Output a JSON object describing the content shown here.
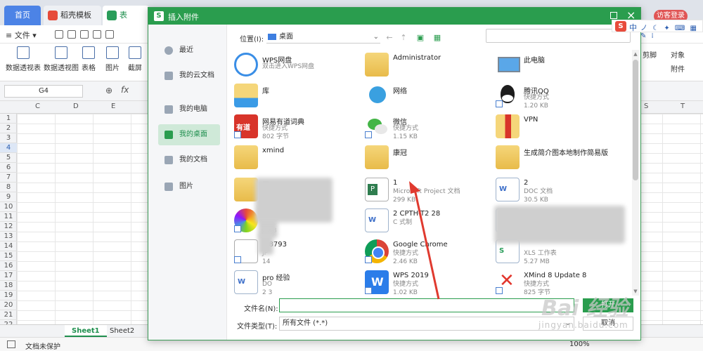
{
  "tabs": [
    {
      "label": "首页"
    },
    {
      "label": "稻壳模板"
    },
    {
      "label": "表格.xls"
    }
  ],
  "guest_login": "访客登录",
  "menu": {
    "file": "文件"
  },
  "ribbon": {
    "buttons": [
      "数据透视表",
      "数据透视图",
      "表格",
      "图片",
      "截屏"
    ],
    "right": [
      "剪脚",
      "对象",
      "附件"
    ]
  },
  "formula_bar": {
    "cell": "G4",
    "fx": "fx"
  },
  "columns": [
    "C",
    "D",
    "E",
    "S",
    "T"
  ],
  "rows": [
    "1",
    "2",
    "3",
    "4",
    "5",
    "6",
    "7",
    "8",
    "9",
    "10",
    "11",
    "12",
    "13",
    "14",
    "15",
    "16",
    "17",
    "18",
    "19",
    "20",
    "21",
    "22"
  ],
  "active_row": "4",
  "sheets": [
    "Sheet1",
    "Sheet2"
  ],
  "status": {
    "protect": "文档未保护",
    "zoom": "100%"
  },
  "dialog": {
    "title": "插入附件",
    "sidebar": [
      {
        "label": "最近",
        "icon": "clock-icon"
      },
      {
        "label": "我的云文档",
        "icon": "cloud-icon"
      },
      {
        "label": "我的电脑",
        "icon": "computer-icon"
      },
      {
        "label": "我的桌面",
        "icon": "desktop-icon",
        "active": true
      },
      {
        "label": "我的文档",
        "icon": "folder-icon"
      },
      {
        "label": "图片",
        "icon": "image-icon"
      }
    ],
    "location_label": "位置(I):",
    "location_value": "桌面",
    "files": [
      {
        "name": "WPS网盘",
        "sub1": "双击进入WPS网盘",
        "sub2": "",
        "icon": "cloud"
      },
      {
        "name": "Administrator",
        "sub1": "",
        "sub2": "",
        "icon": "folder"
      },
      {
        "name": "此电脑",
        "sub1": "",
        "sub2": "",
        "icon": "pc"
      },
      {
        "name": "库",
        "sub1": "",
        "sub2": "",
        "icon": "lib"
      },
      {
        "name": "网络",
        "sub1": "",
        "sub2": "",
        "icon": "net"
      },
      {
        "name": "腾讯QQ",
        "sub1": "快捷方式",
        "sub2": "1.20 KB",
        "icon": "qq"
      },
      {
        "name": "网易有道词典",
        "sub1": "快捷方式",
        "sub2": "802 字节",
        "icon": "red"
      },
      {
        "name": "微信",
        "sub1": "快捷方式",
        "sub2": "1.15 KB",
        "icon": "wechat"
      },
      {
        "name": "VPN",
        "sub1": "",
        "sub2": "",
        "icon": "vpn"
      },
      {
        "name": "xmind",
        "sub1": "",
        "sub2": "",
        "icon": "folder"
      },
      {
        "name": "康冠",
        "sub1": "",
        "sub2": "",
        "icon": "folder"
      },
      {
        "name": "生成简介图本地制作简易版",
        "sub1": "",
        "sub2": "",
        "icon": "folder"
      },
      {
        "name": "图",
        "sub1": "",
        "sub2": "",
        "icon": "folder"
      },
      {
        "name": "1",
        "sub1": "Microsoft Project 文档",
        "sub2": "299 KB",
        "icon": "proj"
      },
      {
        "name": "2",
        "sub1": "DOC 文档",
        "sub2": "30.5 KB",
        "icon": "doc"
      },
      {
        "name": "3",
        "sub1": "器",
        "sub2": "1 KB",
        "icon": "color"
      },
      {
        "name": "2 CPTH-T2 28",
        "sub1": "C 式制",
        "sub2": "",
        "icon": "doc"
      },
      {
        "name": "",
        "sub1": "DOC 文档",
        "sub2": "",
        "icon": "doc"
      },
      {
        "name": "1 8793",
        "sub1": "JP",
        "sub2": "14",
        "icon": "jpg"
      },
      {
        "name": "Google Chrome",
        "sub1": "快捷方式",
        "sub2": "2.46 KB",
        "icon": "chrome"
      },
      {
        "name": "",
        "sub1": "XLS 工作表",
        "sub2": "5.27 MB",
        "icon": "xls"
      },
      {
        "name": "pro 经验",
        "sub1": "DO",
        "sub2": "2 3",
        "icon": "doc"
      },
      {
        "name": "WPS 2019",
        "sub1": "快捷方式",
        "sub2": "1.02 KB",
        "icon": "wps"
      },
      {
        "name": "XMind 8 Update 8",
        "sub1": "快捷方式",
        "sub2": "825 字节",
        "icon": "xmind"
      }
    ],
    "filename_label": "文件名(N):",
    "filename_value": "",
    "open_label": "打开",
    "filetype_label": "文件类型(T):",
    "filetype_value": "所有文件 (*.*)",
    "cancel_label": "取消"
  },
  "ime": {
    "zh": "中",
    "rest": "ノ ☾ ✦ ⌨ ▦ ✎ ⁞"
  },
  "watermark": {
    "main": "Bai 经验",
    "sub": "jingyan.baidu.com"
  }
}
